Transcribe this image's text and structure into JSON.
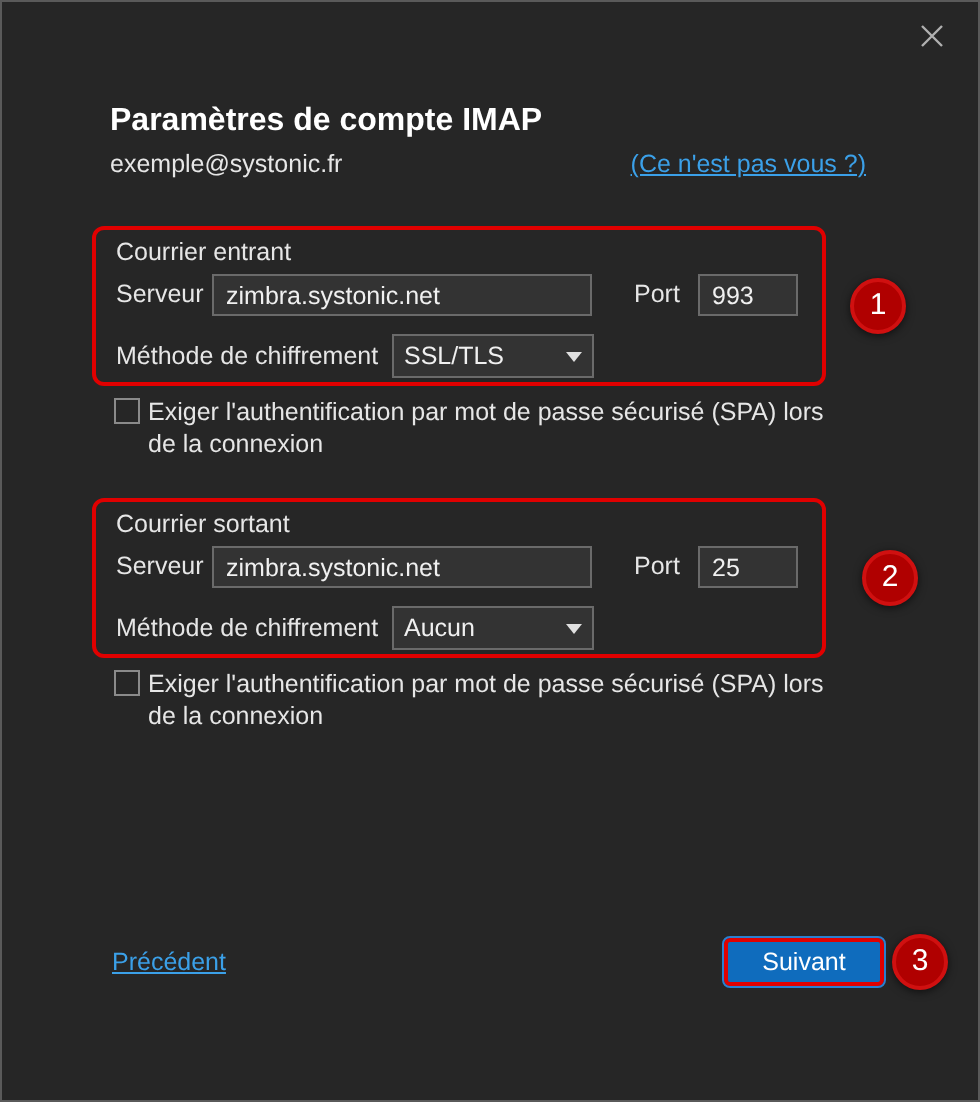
{
  "dialog": {
    "title": "Paramètres de compte IMAP",
    "account": "exemple@systonic.fr",
    "switch_link": "(Ce n'est pas vous ?)"
  },
  "sections": [
    {
      "heading": "Courrier entrant",
      "server_label": "Serveur",
      "server": "zimbra.systonic.net",
      "port_label": "Port",
      "port": "993",
      "encryption_label": "Méthode de chiffrement",
      "encryption": "SSL/TLS",
      "annotation": "1",
      "spa_label": "Exiger l'authentification par mot de passe sécurisé (SPA) lors de la connexion",
      "spa_checked": false
    },
    {
      "heading": "Courrier sortant",
      "server_label": "Serveur",
      "server": "zimbra.systonic.net",
      "port_label": "Port",
      "port": "25",
      "encryption_label": "Méthode de chiffrement",
      "encryption": "Aucun",
      "annotation": "2",
      "spa_label": "Exiger l'authentification par mot de passe sécurisé (SPA) lors de la connexion",
      "spa_checked": false
    }
  ],
  "footer": {
    "back_link": "Précédent",
    "next_button": "Suivant",
    "annotation": "3"
  }
}
